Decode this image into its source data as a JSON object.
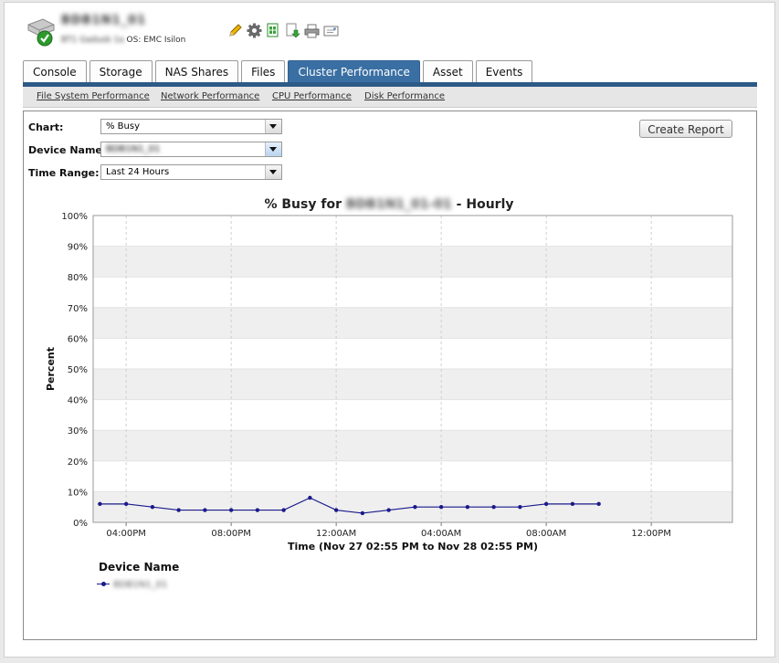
{
  "header": {
    "device_name": "BDB1N1_01",
    "device_sub": "BT1 Gadusb 1a",
    "os_label": "OS: EMC Isilon",
    "toolbar_icons": [
      "edit-icon",
      "settings-gear-icon",
      "export-icon",
      "download-icon",
      "print-icon",
      "email-icon"
    ]
  },
  "tabs": [
    {
      "label": "Console",
      "active": false
    },
    {
      "label": "Storage",
      "active": false
    },
    {
      "label": "NAS Shares",
      "active": false
    },
    {
      "label": "Files",
      "active": false
    },
    {
      "label": "Cluster Performance",
      "active": true
    },
    {
      "label": "Asset",
      "active": false
    },
    {
      "label": "Events",
      "active": false
    }
  ],
  "subnav": [
    "File System Performance",
    "Network Performance",
    "CPU Performance",
    "Disk Performance"
  ],
  "form": {
    "chart_label": "Chart:",
    "chart_value": "% Busy",
    "device_label": "Device Name:",
    "device_value": "BDB1N1_01",
    "time_label": "Time Range:",
    "time_value": "Last 24 Hours",
    "create_report": "Create Report"
  },
  "chart_title_prefix": "% Busy for",
  "chart_title_device": "BDB1N1_01-01",
  "chart_title_suffix": "- Hourly",
  "legend_title": "Device Name",
  "legend_label": "BDB1N1_01",
  "chart_data": {
    "type": "line",
    "title": "% Busy for BDB1N1_01 - Hourly",
    "xlabel": "Time (Nov 27 02:55 PM to Nov 28 02:55 PM)",
    "ylabel": "Percent",
    "y_ticks": [
      "0%",
      "10%",
      "20%",
      "30%",
      "40%",
      "50%",
      "60%",
      "70%",
      "80%",
      "90%",
      "100%"
    ],
    "ylim": [
      0,
      100
    ],
    "x_range": [
      "Nov 27 02:55 PM",
      "Nov 28 02:55 PM"
    ],
    "x_ticks": [
      "04:00PM",
      "08:00PM",
      "12:00AM",
      "04:00AM",
      "08:00AM",
      "12:00PM"
    ],
    "grid": true,
    "legend_position": "bottom-left",
    "series": [
      {
        "name": "BDB1N1_01",
        "color": "#1a1a8c",
        "x": [
          "Nov 27 03:00 PM",
          "Nov 27 04:00 PM",
          "Nov 27 05:00 PM",
          "Nov 27 06:00 PM",
          "Nov 27 07:00 PM",
          "Nov 27 08:00 PM",
          "Nov 27 09:00 PM",
          "Nov 27 10:00 PM",
          "Nov 27 11:00 PM",
          "Nov 28 12:00 AM",
          "Nov 28 01:00 AM",
          "Nov 28 02:00 AM",
          "Nov 28 03:00 AM",
          "Nov 28 04:00 AM",
          "Nov 28 05:00 AM",
          "Nov 28 06:00 AM",
          "Nov 28 07:00 AM",
          "Nov 28 08:00 AM",
          "Nov 28 09:00 AM",
          "Nov 28 10:00 AM"
        ],
        "values": [
          6,
          6,
          5,
          4,
          4,
          4,
          4,
          4,
          8,
          4,
          3,
          4,
          5,
          5,
          5,
          5,
          5,
          6,
          6,
          6
        ]
      }
    ]
  }
}
